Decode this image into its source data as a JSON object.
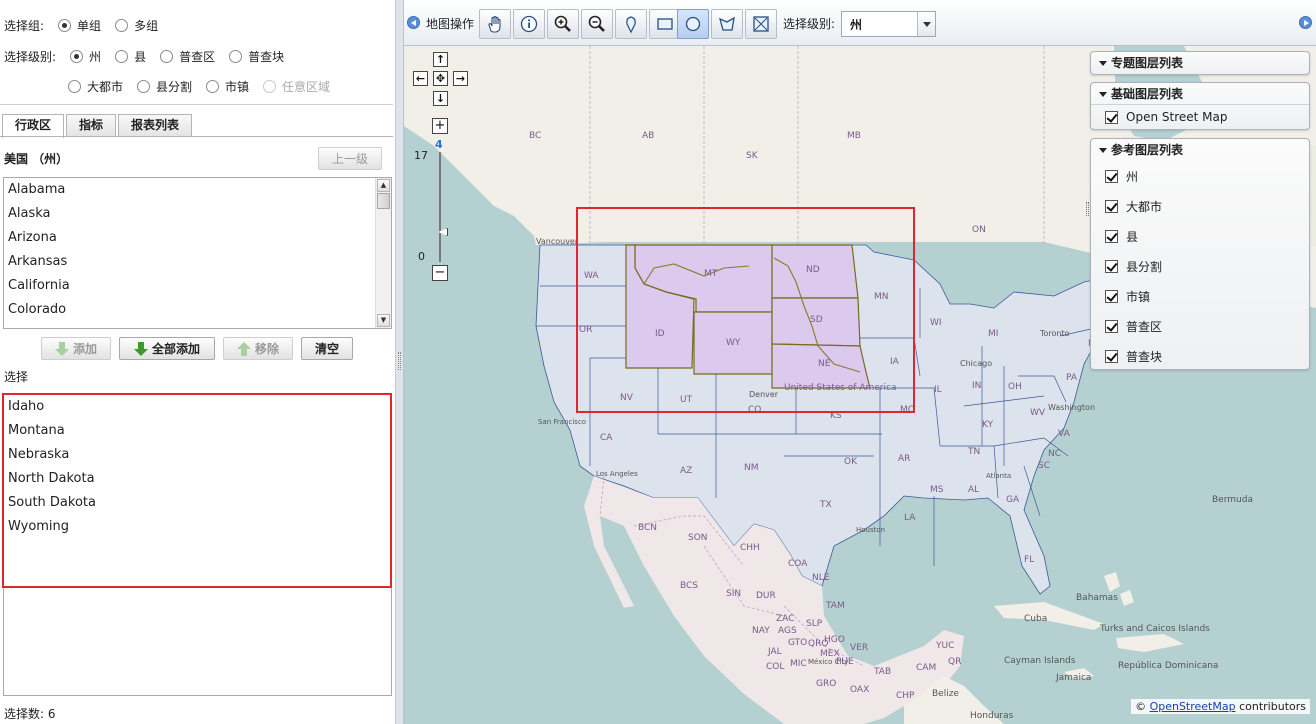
{
  "left_panel": {
    "group": {
      "label": "选择组:",
      "options": [
        {
          "label": "单组",
          "selected": true
        },
        {
          "label": "多组",
          "selected": false
        }
      ]
    },
    "level": {
      "label": "选择级别:",
      "options_row1": [
        {
          "label": "州",
          "selected": true
        },
        {
          "label": "县",
          "selected": false
        },
        {
          "label": "普查区",
          "selected": false
        },
        {
          "label": "普查块",
          "selected": false
        }
      ],
      "options_row2": [
        {
          "label": "大都市",
          "selected": false
        },
        {
          "label": "县分割",
          "selected": false
        },
        {
          "label": "市镇",
          "selected": false
        },
        {
          "label": "任意区域",
          "selected": false,
          "disabled": true
        }
      ]
    },
    "tabs": [
      "行政区",
      "指标",
      "报表列表"
    ],
    "breadcrumb": "美国 （州）",
    "up_button": "上一级",
    "available_items": [
      "Alabama",
      "Alaska",
      "Arizona",
      "Arkansas",
      "California",
      "Colorado"
    ],
    "buttons": {
      "add": "添加",
      "add_all": "全部添加",
      "remove": "移除",
      "clear": "清空"
    },
    "selection_label": "选择",
    "selected_items": [
      "Idaho",
      "Montana",
      "Nebraska",
      "North Dakota",
      "South Dakota",
      "Wyoming"
    ],
    "selection_count": "选择数: 6"
  },
  "toolbar": {
    "map_ops_label": "地图操作",
    "tools": [
      "pan-hand-icon",
      "info-icon",
      "zoom-in-icon",
      "zoom-out-icon",
      "marker-icon",
      "rectangle-icon",
      "circle-icon",
      "polygon-icon",
      "clear-selection-icon"
    ],
    "level_label": "选择级别:",
    "level_value": "州"
  },
  "map": {
    "zoom_max": "17",
    "zoom_current": "4",
    "zoom_min": "0",
    "labels": {
      "bc": "BC",
      "ab": "AB",
      "mb": "MB",
      "sk": "SK",
      "on": "ON",
      "vancouver": "Vancouver",
      "toronto": "Toronto",
      "chicago": "Chicago",
      "washington": "Washington",
      "denver": "Denver",
      "wa": "WA",
      "or": "OR",
      "ca": "CA",
      "nv": "NV",
      "id": "ID",
      "mt": "MT",
      "wy": "WY",
      "ut": "UT",
      "co": "CO",
      "az": "AZ",
      "nm": "NM",
      "nd": "ND",
      "sd": "SD",
      "ne": "NE",
      "ks": "KS",
      "ok": "OK",
      "tx": "TX",
      "mn": "MN",
      "ia": "IA",
      "mo": "MO",
      "ar": "AR",
      "la": "LA",
      "wi": "WI",
      "mi": "MI",
      "il": "IL",
      "in": "IN",
      "oh": "OH",
      "ky": "KY",
      "tn": "TN",
      "ms": "MS",
      "al": "AL",
      "ga": "GA",
      "fl": "FL",
      "sc": "SC",
      "nc": "NC",
      "va": "VA",
      "wv": "WV",
      "pa": "PA",
      "ny": "NY",
      "usa": "United States of America",
      "sf": "San Francisco",
      "la_city": "Los Angeles",
      "houston": "Houston",
      "atlanta": "Atlanta",
      "bcn": "BCN",
      "son": "SON",
      "chh": "CHH",
      "bcs": "BCS",
      "coa": "COA",
      "nle": "NLE",
      "sin": "SIN",
      "dur": "DUR",
      "tam": "TAM",
      "zac": "ZAC",
      "slp": "SLP",
      "nay": "NAY",
      "ags": "AGS",
      "jal": "JAL",
      "gto": "GTO",
      "qro": "QRO",
      "hgo": "HGO",
      "col": "COL",
      "mic": "MIC",
      "mex": "MEX",
      "mexico_city": "México City",
      "pue": "PUE",
      "ver": "VER",
      "oax": "OAX",
      "tab": "TAB",
      "gro": "GRO",
      "chp": "CHP",
      "yuc": "YUC",
      "qr": "QR",
      "cam": "CAM",
      "belize": "Belize",
      "bermuda": "Bermuda",
      "bahamas": "Bahamas",
      "cuba": "Cuba",
      "turks": "Turks and Caicos Islands",
      "cayman": "Cayman Islands",
      "jamaica": "Jamaica",
      "dominicana": "República Dominicana",
      "honduras": "Honduras"
    },
    "attribution_prefix": "©",
    "attribution_link": "OpenStreetMap",
    "attribution_suffix": "contributors",
    "colors": {
      "selected_fill": "#dcc9ee",
      "state_fill": "#dde3ec",
      "highlight": "#e0282a"
    }
  },
  "layer_panels": {
    "thematic_title": "专题图层列表",
    "base_title": "基础图层列表",
    "base_layers": [
      {
        "label": "Open Street Map",
        "checked": true
      }
    ],
    "reference_title": "参考图层列表",
    "reference_layers": [
      {
        "label": "州",
        "checked": true
      },
      {
        "label": "大都市",
        "checked": true
      },
      {
        "label": "县",
        "checked": true
      },
      {
        "label": "县分割",
        "checked": true
      },
      {
        "label": "市镇",
        "checked": true
      },
      {
        "label": "普查区",
        "checked": true
      },
      {
        "label": "普查块",
        "checked": true
      }
    ]
  }
}
